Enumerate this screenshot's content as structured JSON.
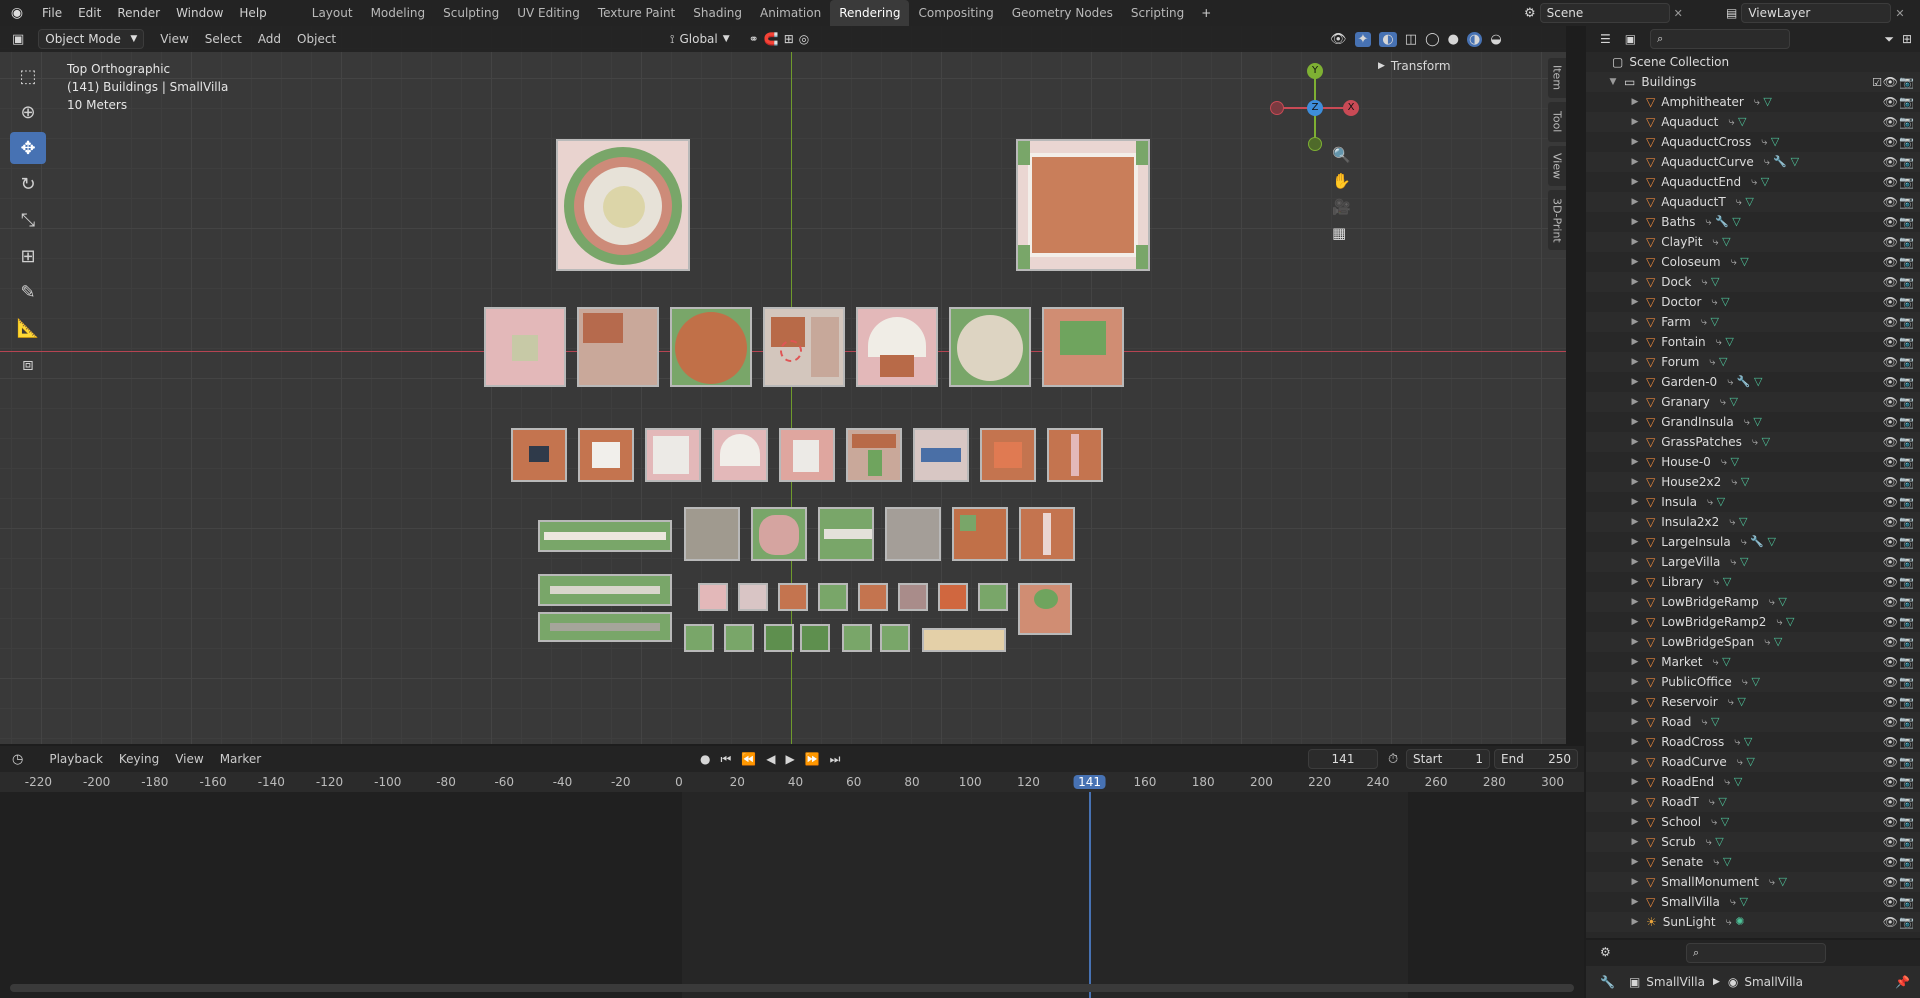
{
  "topbar": {
    "menus": [
      "File",
      "Edit",
      "Render",
      "Window",
      "Help"
    ],
    "workspaces": [
      "Layout",
      "Modeling",
      "Sculpting",
      "UV Editing",
      "Texture Paint",
      "Shading",
      "Animation",
      "Rendering",
      "Compositing",
      "Geometry Nodes",
      "Scripting"
    ],
    "active_workspace": "Rendering",
    "add_tab": "+",
    "scene": "Scene",
    "view_layer": "ViewLayer"
  },
  "viewport_header": {
    "mode": "Object Mode",
    "menus": [
      "View",
      "Select",
      "Add",
      "Object"
    ],
    "orientation": "Global"
  },
  "viewport": {
    "view_name": "Top Orthographic",
    "collection_info": "(141) Buildings | SmallVilla",
    "scale_info": "10 Meters",
    "transform_panel": "Transform",
    "side_tabs": [
      "Item",
      "Tool",
      "View",
      "3D-Print"
    ],
    "gizmo_axes": [
      "Y",
      "Z",
      "X"
    ],
    "colors": {
      "x_axis": "#c94a55",
      "y_axis": "#7eb033",
      "z_axis": "#3e8edb",
      "accent": "#4772b3"
    }
  },
  "timeline": {
    "menus": [
      "Playback",
      "Keying",
      "View",
      "Marker"
    ],
    "current_frame": "141",
    "start_label": "Start",
    "start_value": "1",
    "end_label": "End",
    "end_value": "250",
    "ruler_ticks": [
      "-220",
      "-200",
      "-180",
      "-160",
      "-140",
      "-120",
      "-100",
      "-80",
      "-60",
      "-40",
      "-20",
      "0",
      "20",
      "40",
      "60",
      "80",
      "100",
      "120",
      "141",
      "160",
      "180",
      "200",
      "220",
      "240",
      "260",
      "280",
      "300"
    ]
  },
  "outliner": {
    "root": "Scene Collection",
    "collection": "Buildings",
    "items": [
      {
        "name": "Amphitheater",
        "mods": "both"
      },
      {
        "name": "Aquaduct",
        "mods": "both"
      },
      {
        "name": "AquaductCross",
        "mods": "both"
      },
      {
        "name": "AquaductCurve",
        "mods": "three"
      },
      {
        "name": "AquaductEnd",
        "mods": "both"
      },
      {
        "name": "AquaductT",
        "mods": "both"
      },
      {
        "name": "Baths",
        "mods": "three"
      },
      {
        "name": "ClayPit",
        "mods": "both"
      },
      {
        "name": "Coloseum",
        "mods": "both"
      },
      {
        "name": "Dock",
        "mods": "both"
      },
      {
        "name": "Doctor",
        "mods": "both"
      },
      {
        "name": "Farm",
        "mods": "both"
      },
      {
        "name": "Fontain",
        "mods": "both"
      },
      {
        "name": "Forum",
        "mods": "both"
      },
      {
        "name": "Garden-0",
        "mods": "three"
      },
      {
        "name": "Granary",
        "mods": "both"
      },
      {
        "name": "GrandInsula",
        "mods": "both"
      },
      {
        "name": "GrassPatches",
        "mods": "both"
      },
      {
        "name": "House-0",
        "mods": "both"
      },
      {
        "name": "House2x2",
        "mods": "both"
      },
      {
        "name": "Insula",
        "mods": "both"
      },
      {
        "name": "Insula2x2",
        "mods": "both"
      },
      {
        "name": "LargeInsula",
        "mods": "three"
      },
      {
        "name": "LargeVilla",
        "mods": "both"
      },
      {
        "name": "Library",
        "mods": "both"
      },
      {
        "name": "LowBridgeRamp",
        "mods": "both"
      },
      {
        "name": "LowBridgeRamp2",
        "mods": "both"
      },
      {
        "name": "LowBridgeSpan",
        "mods": "both"
      },
      {
        "name": "Market",
        "mods": "both"
      },
      {
        "name": "PublicOffice",
        "mods": "both"
      },
      {
        "name": "Reservoir",
        "mods": "both"
      },
      {
        "name": "Road",
        "mods": "both"
      },
      {
        "name": "RoadCross",
        "mods": "both"
      },
      {
        "name": "RoadCurve",
        "mods": "both"
      },
      {
        "name": "RoadEnd",
        "mods": "both"
      },
      {
        "name": "RoadT",
        "mods": "both"
      },
      {
        "name": "School",
        "mods": "both"
      },
      {
        "name": "Scrub",
        "mods": "both"
      },
      {
        "name": "Senate",
        "mods": "both"
      },
      {
        "name": "SmallMonument",
        "mods": "both"
      },
      {
        "name": "SmallVilla",
        "mods": "both"
      },
      {
        "name": "SunLight",
        "mods": "light"
      }
    ]
  },
  "properties": {
    "breadcrumb_object": "SmallVilla",
    "breadcrumb_data": "SmallVilla"
  }
}
